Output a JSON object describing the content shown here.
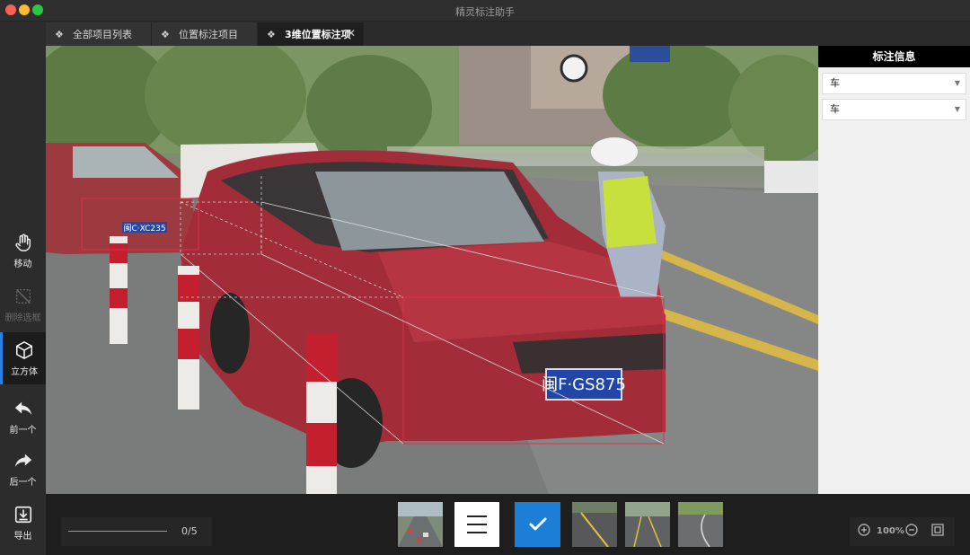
{
  "window": {
    "title": "精灵标注助手"
  },
  "tabs": [
    {
      "label": "全部项目列表",
      "active": false,
      "closable": false
    },
    {
      "label": "位置标注项目",
      "active": false,
      "closable": false
    },
    {
      "label": "3维位置标注项",
      "active": true,
      "closable": true
    }
  ],
  "toolbar": {
    "move": "移动",
    "delete_box": "删除选框",
    "cube": "立方体",
    "prev": "前一个",
    "next": "后一个",
    "export": "导出"
  },
  "image": {
    "plate_main": "闽F·GS875",
    "plate_left": "闽C·XC235"
  },
  "panel": {
    "title": "标注信息",
    "select_1": "车",
    "select_2": "车"
  },
  "bottom": {
    "progress_text": "0/5",
    "zoom_level": "100%"
  },
  "icons": [
    "hand-icon",
    "delete-box-icon",
    "cube-icon",
    "undo-arrow-icon",
    "redo-arrow-icon",
    "export-icon",
    "zoom-in-icon",
    "zoom-out-icon",
    "fullscreen-icon",
    "check-icon",
    "list-icon",
    "tab-diamond-icon",
    "close-icon"
  ],
  "colors": {
    "accent": "#1c7ed6",
    "bbox": "#e0304a",
    "panel_header": "#000000"
  }
}
